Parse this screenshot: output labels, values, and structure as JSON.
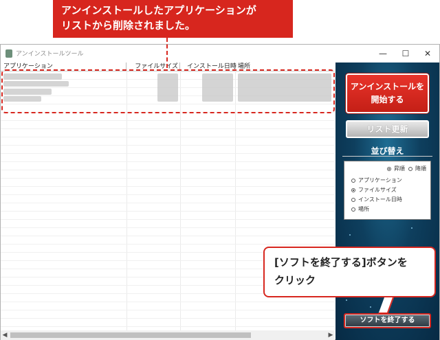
{
  "annotation_top": {
    "line1": "アンインストールしたアプリケーションが",
    "line2": "リストから削除されました。"
  },
  "window": {
    "title": "アンインストールツール",
    "minimize": "—",
    "maximize": "☐",
    "close": "✕"
  },
  "columns": [
    "アプリケーション",
    "ファイルサイズ",
    "インストール日時",
    "場所"
  ],
  "panel": {
    "start_button": {
      "line1": "アンインストールを",
      "line2": "開始する"
    },
    "refresh_button": "リスト更新",
    "sort_title": "並び替え",
    "order": {
      "asc": "昇順",
      "desc": "降順",
      "selected": "asc"
    },
    "sort_options": [
      "アプリケーション",
      "ファイルサイズ",
      "インストール日時",
      "場所"
    ],
    "sort_selected": "ファイルサイズ",
    "quit_button": "ソフトを終了する"
  },
  "annotation_bottom": {
    "line1": "[ソフトを終了する]ボタンを",
    "line2": "クリック"
  },
  "colors": {
    "accent": "#d7261e",
    "panel": "#0e3f5e"
  },
  "icons": [
    "app-icon",
    "minimize-icon",
    "maximize-icon",
    "close-icon",
    "scroll-left-icon",
    "scroll-right-icon"
  ]
}
